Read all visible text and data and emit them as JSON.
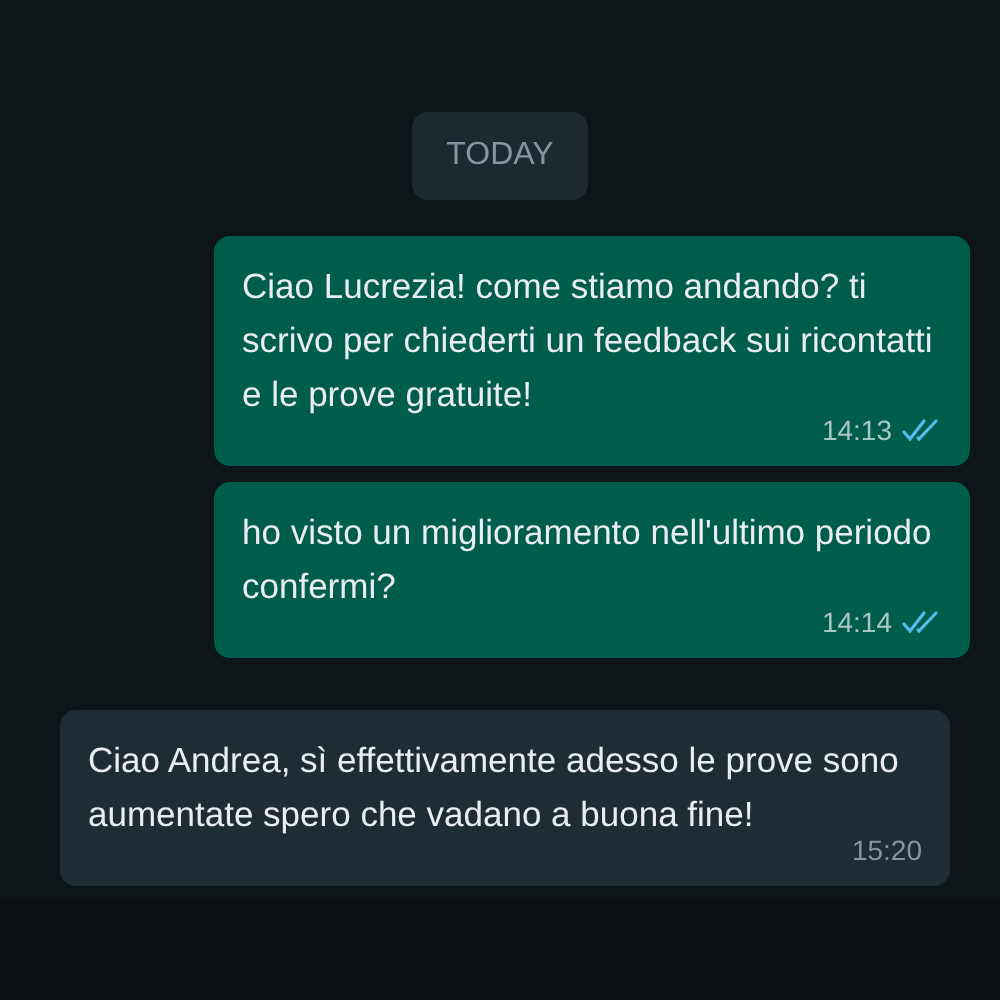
{
  "date_chip": "TODAY",
  "messages": [
    {
      "kind": "out",
      "text": "Ciao Lucrezia! come stiamo andando? ti scrivo per chiederti un feedback sui ricontatti e le prove gratuite!",
      "time": "14:13",
      "read": true
    },
    {
      "kind": "out",
      "text": "ho visto un miglioramento nell'ultimo periodo confermi?",
      "time": "14:14",
      "read": true
    },
    {
      "kind": "in",
      "text": "Ciao Andrea, sì effettivamente adesso le prove sono aumentate spero che vadano a buona fine!",
      "time": "15:20"
    }
  ]
}
